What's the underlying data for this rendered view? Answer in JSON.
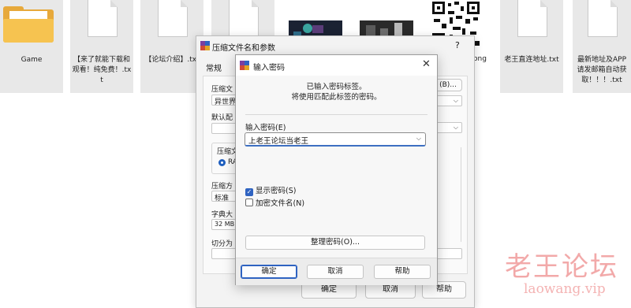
{
  "desktop": {
    "files": [
      {
        "label": "Game",
        "kind": "folder"
      },
      {
        "label": "【来了就能下载和观看！纯免费！.txt",
        "kind": "txt"
      },
      {
        "label": "【论坛介绍】.txt",
        "kind": "txt"
      },
      {
        "label": "",
        "kind": "txt"
      },
      {
        "label": "",
        "kind": "image"
      },
      {
        "label": "",
        "kind": "image"
      },
      {
        "label": "ong",
        "kind": "qr"
      },
      {
        "label": "老王直连地址.txt",
        "kind": "txt"
      },
      {
        "label": "最新地址及APP请发邮箱自动获取！！！.txt",
        "kind": "txt"
      }
    ]
  },
  "archive_dialog": {
    "title": "压缩文件名和参数",
    "help_mark": "?",
    "tab_general": "常规",
    "label_archive_name": "压缩文",
    "archive_name_value": "异世界",
    "browse_button": "(B)...",
    "label_default": "默认配",
    "label_format": "压缩文",
    "format_value": "RA",
    "label_method": "压缩方",
    "method_value": "标准",
    "label_dictionary": "字典大",
    "dictionary_value": "32 MB",
    "label_split": "切分为",
    "ok_button": "确定",
    "cancel_button": "取消",
    "help_button": "帮助"
  },
  "password_dialog": {
    "title": "输入密码",
    "close_glyph": "✕",
    "message_line1": "已输入密码标签。",
    "message_line2": "将使用匹配此标签的密码。",
    "enter_password_label": "输入密码(E)",
    "password_value": "上老王论坛当老王",
    "show_password_label": "显示密码(S)",
    "show_password_checked": true,
    "encrypt_names_label": "加密文件名(N)",
    "encrypt_names_checked": false,
    "organize_button": "整理密码(O)...",
    "ok_button": "确定",
    "cancel_button": "取消",
    "help_button": "帮助"
  },
  "watermark": {
    "chinese": "老王论坛",
    "latin": "laowang.vip"
  },
  "colors": {
    "accent": "#2f63c1",
    "folder": "#f6c350",
    "watermark": "#f2a9a9"
  }
}
